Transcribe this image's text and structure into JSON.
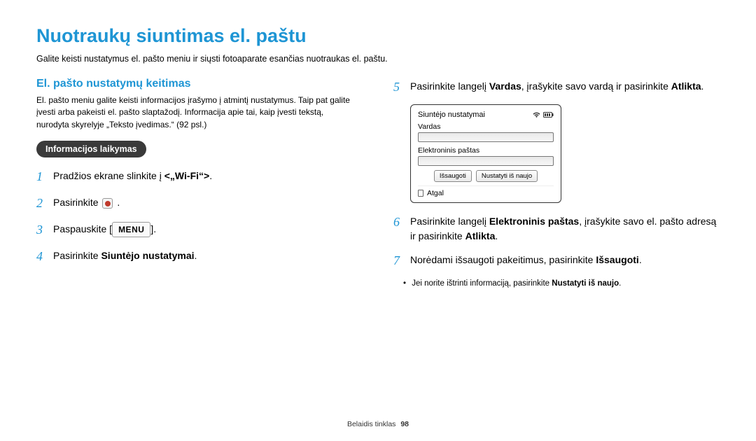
{
  "title": "Nuotraukų siuntimas el. paštu",
  "subtitle": "Galite keisti nustatymus el. pašto meniu ir siųsti fotoaparate esančias nuotraukas el. paštu.",
  "section_title": "El. pašto nustatymų keitimas",
  "section_body": "El. pašto meniu galite keisti informacijos įrašymo į atmintį nustatymus. Taip pat galite įvesti arba pakeisti el. pašto slaptažodį. Informacija apie tai, kaip įvesti tekstą, nurodyta skyrelyje „Teksto įvedimas.“ (92 psl.)",
  "badge": "Informacijos laikymas",
  "steps_left": {
    "s1_a": "Pradžios ekrane slinkite į ",
    "s1_b": "<„Wi-Fi“>",
    "s1_c": ".",
    "s2_a": "Pasirinkite ",
    "s2_b": " .",
    "s3_a": "Paspauskite [",
    "s3_menu": "MENU",
    "s3_b": "].",
    "s4_a": "Pasirinkite ",
    "s4_b": "Siuntėjo nustatymai",
    "s4_c": "."
  },
  "steps_right": {
    "s5_a": "Pasirinkite langelį ",
    "s5_b": "Vardas",
    "s5_c": ", įrašykite savo vardą ir pasirinkite ",
    "s5_d": "Atlikta",
    "s5_e": ".",
    "s6_a": "Pasirinkite langelį ",
    "s6_b": "Elektroninis paštas",
    "s6_c": ", įrašykite savo el. pašto adresą ir pasirinkite ",
    "s6_d": "Atlikta",
    "s6_e": ".",
    "s7_a": "Norėdami išsaugoti pakeitimus, pasirinkite ",
    "s7_b": "Išsaugoti",
    "s7_c": ".",
    "sub_a": "Jei norite ištrinti informaciją, pasirinkite ",
    "sub_b": "Nustatyti iš naujo",
    "sub_c": "."
  },
  "device": {
    "title": "Siuntėjo nustatymai",
    "field1": "Vardas",
    "field2": "Elektroninis paštas",
    "btn1": "Išsaugoti",
    "btn2": "Nustatyti iš naujo",
    "back": "Atgal"
  },
  "footer": {
    "label": "Belaidis tinklas",
    "page": "98"
  }
}
